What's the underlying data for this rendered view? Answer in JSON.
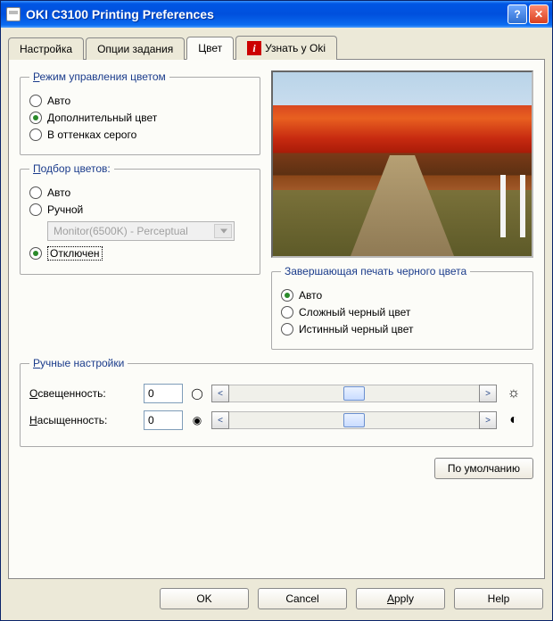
{
  "window": {
    "title": "OKI C3100 Printing Preferences"
  },
  "tabs": {
    "setup": "Настройка",
    "job_options": "Опции задания",
    "color": "Цвет",
    "ask_oki": "Узнать у Oki"
  },
  "color_mode": {
    "legend_u": "Р",
    "legend_rest": "ежим управления цветом",
    "auto": "Авто",
    "advanced": "Дополнительный цвет",
    "grayscale": "В оттенках серого"
  },
  "matching": {
    "legend_u": "П",
    "legend_rest": "одбор цветов:",
    "auto": "Авто",
    "manual": "Ручной",
    "select_value": "Monitor(6500K) - Perceptual",
    "disabled": "Отключен"
  },
  "black_finish": {
    "legend": "Завершающая печать черного цвета",
    "auto": "Авто",
    "composite": "Сложный черный цвет",
    "true_black": "Истинный черный цвет"
  },
  "manual": {
    "legend_u": "Р",
    "legend_rest": "учные настройки",
    "brightness_u": "О",
    "brightness_rest": "свещенность:",
    "brightness_val": "0",
    "saturation_u": "Н",
    "saturation_rest": "асыщенность:",
    "saturation_val": "0"
  },
  "buttons": {
    "default": "По умолчанию",
    "ok": "OK",
    "cancel": "Cancel",
    "apply_u": "A",
    "apply_rest": "pply",
    "help": "Help"
  }
}
